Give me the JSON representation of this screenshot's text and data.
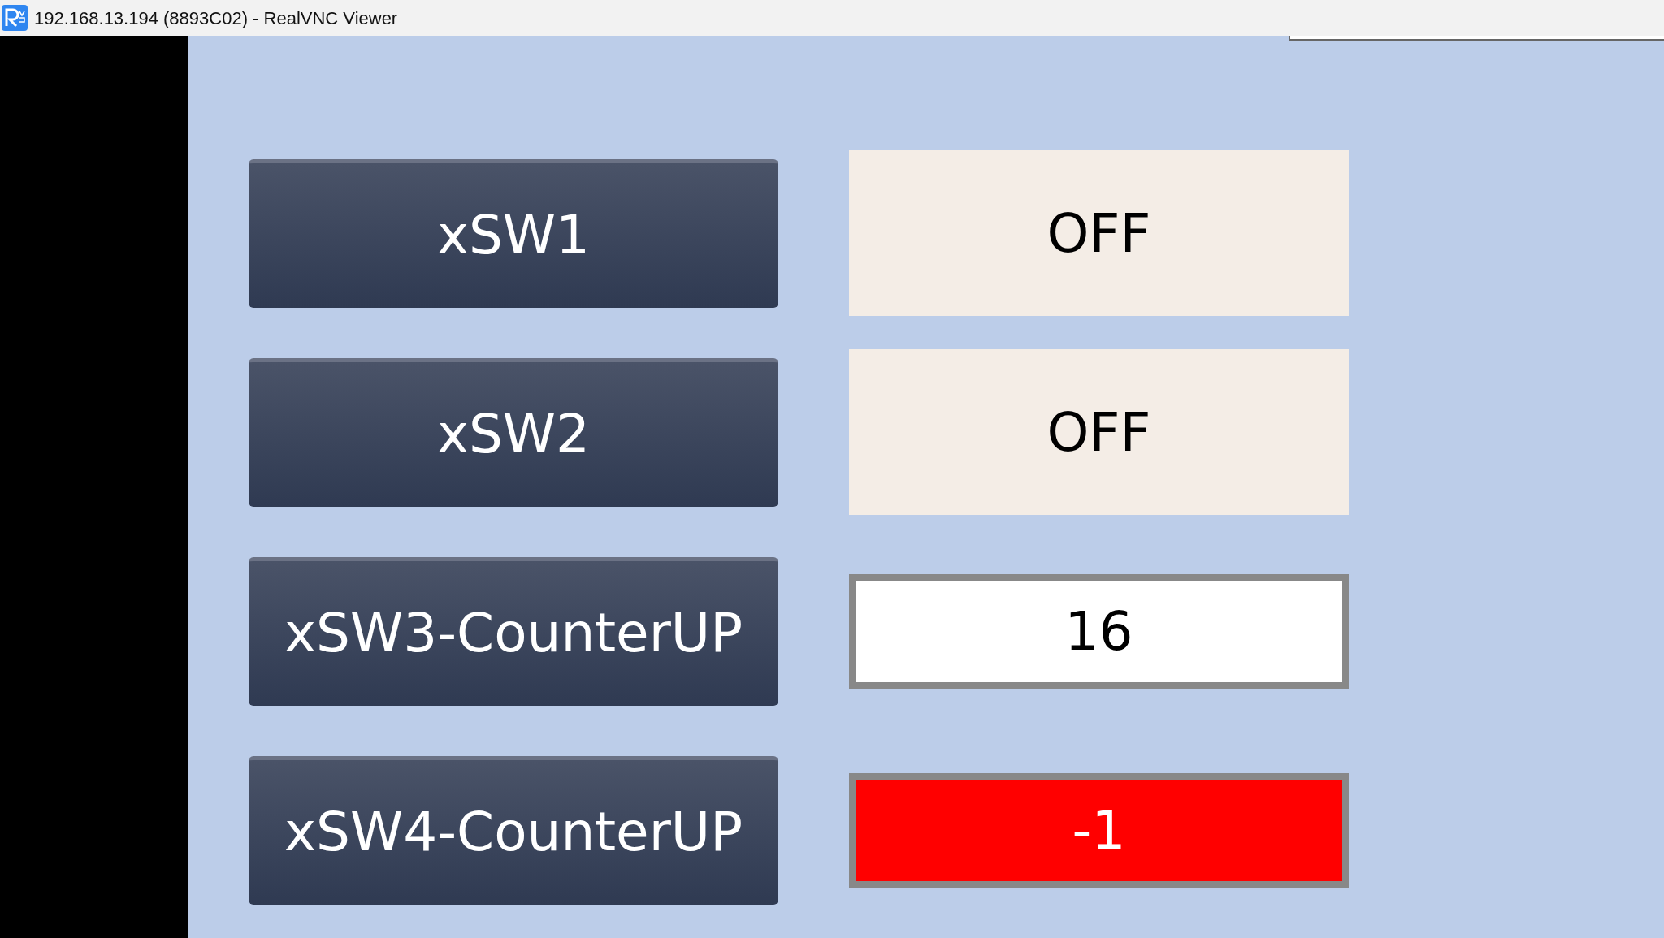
{
  "window": {
    "title": "192.168.13.194 (8893C02) - RealVNC Viewer"
  },
  "rows": [
    {
      "button": "xSW1",
      "display": {
        "kind": "status",
        "value": "OFF",
        "alarm": false
      }
    },
    {
      "button": "xSW2",
      "display": {
        "kind": "status",
        "value": "OFF",
        "alarm": false
      }
    },
    {
      "button": "xSW3-CounterUP",
      "display": {
        "kind": "numeric",
        "value": "16",
        "alarm": false
      }
    },
    {
      "button": "xSW4-CounterUP",
      "display": {
        "kind": "numeric",
        "value": "-1",
        "alarm": true
      }
    }
  ]
}
